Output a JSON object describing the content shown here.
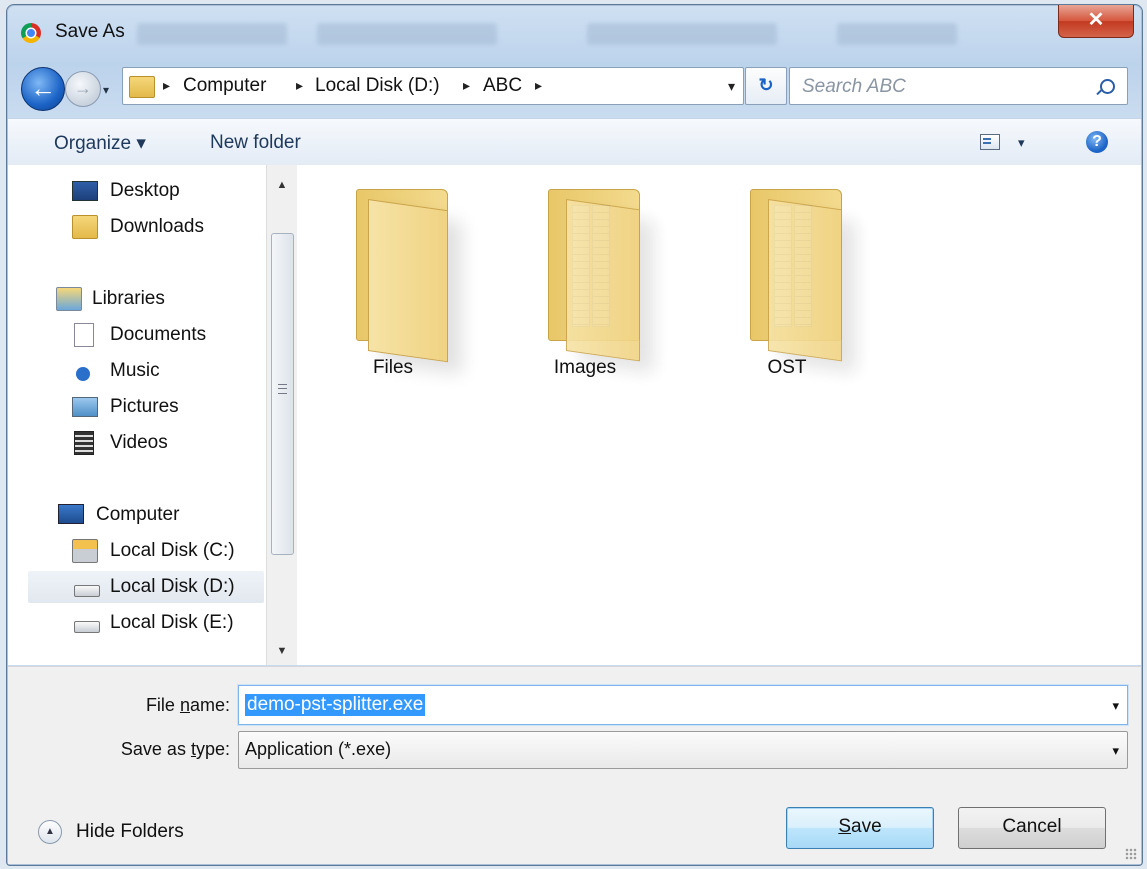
{
  "window": {
    "title": "Save As",
    "close_glyph": "✕"
  },
  "nav": {
    "back_glyph": "←",
    "forward_glyph": "→",
    "history_glyph": "▾",
    "breadcrumb": [
      "Computer",
      "Local Disk (D:)",
      "ABC"
    ],
    "crumb_sep": "▸",
    "address_dropdown_glyph": "▾",
    "refresh_glyph": "↻",
    "search_placeholder": "Search ABC"
  },
  "toolbar": {
    "organize_label": "Organize ▾",
    "new_folder_label": "New folder",
    "view_dropdown_glyph": "▾",
    "help_glyph": "?"
  },
  "sidebar": {
    "items": [
      {
        "label": "Desktop",
        "icon": "desktop-icon"
      },
      {
        "label": "Downloads",
        "icon": "downloads-icon"
      },
      {
        "label": "Libraries",
        "icon": "libraries-icon"
      },
      {
        "label": "Documents",
        "icon": "documents-icon"
      },
      {
        "label": "Music",
        "icon": "music-icon"
      },
      {
        "label": "Pictures",
        "icon": "pictures-icon"
      },
      {
        "label": "Videos",
        "icon": "videos-icon"
      },
      {
        "label": "Computer",
        "icon": "computer-icon"
      },
      {
        "label": "Local Disk (C:)",
        "icon": "system-drive-icon"
      },
      {
        "label": "Local Disk (D:)",
        "icon": "drive-icon",
        "selected": true
      },
      {
        "label": "Local Disk (E:)",
        "icon": "drive-icon"
      }
    ],
    "scroll_up_glyph": "▲",
    "scroll_down_glyph": "▼"
  },
  "files": {
    "folders": [
      {
        "name": "Files"
      },
      {
        "name": "Images"
      },
      {
        "name": "OST"
      }
    ]
  },
  "form": {
    "file_name_label_pre": "File ",
    "file_name_label_u": "n",
    "file_name_label_post": "ame:",
    "file_name_value": "demo-pst-splitter.exe",
    "save_type_label_pre": "Save as ",
    "save_type_label_u": "t",
    "save_type_label_post": "ype:",
    "save_type_value": "Application (*.exe)",
    "dropdown_glyph": "▾",
    "hide_folders_glyph": "▲",
    "hide_folders_label": "Hide Folders",
    "save_label_u": "S",
    "save_label_post": "ave",
    "cancel_label": "Cancel"
  },
  "colors": {
    "selection": "#3399ff",
    "accent": "#1b63c6",
    "close_button": "#c23a20"
  }
}
